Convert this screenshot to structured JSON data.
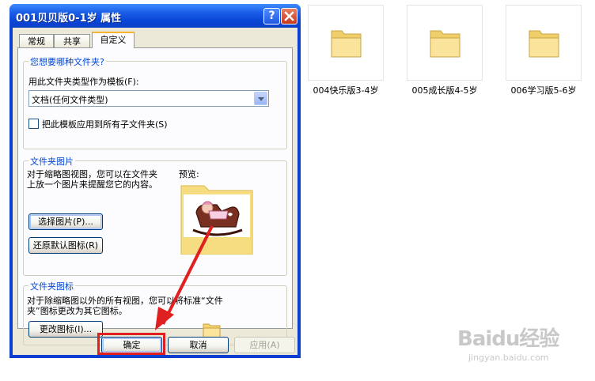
{
  "dialog": {
    "title": "001贝贝版0-1岁 属性",
    "help_btn": "?",
    "close_btn": "✕",
    "tabs": [
      {
        "label": "常规"
      },
      {
        "label": "共享"
      },
      {
        "label": "自定义"
      }
    ],
    "active_tab": "自定义",
    "group_folder_type": {
      "legend": "您想要哪种文件夹?",
      "template_label": "用此文件夹类型作为模板(F):",
      "template_value": "文档(任何文件类型)",
      "apply_checkbox_label": "把此模板应用到所有子文件夹(S)",
      "apply_checked": false
    },
    "group_folder_picture": {
      "legend": "文件夹图片",
      "description_line1": "对于缩略图视图，您可以在文件夹",
      "description_line2": "上放一个图片来提醒您它的内容。",
      "preview_label": "预览:",
      "choose_picture_button": "选择图片(P)...",
      "restore_default_button": "还原默认图标(R)"
    },
    "group_folder_icon": {
      "legend": "文件夹图标",
      "description_line1": "对于除缩略图以外的所有视图，您可以将标准“文件",
      "description_line2": "夹”图标更改为其它图标。",
      "change_icon_button": "更改图标(I)..."
    },
    "footer": {
      "ok_button": "确定",
      "cancel_button": "取消",
      "apply_button": "应用(A)"
    }
  },
  "files": [
    {
      "name": "004快乐版3-4岁",
      "icon": "folder-icon"
    },
    {
      "name": "005成长版4-5岁",
      "icon": "folder-icon"
    },
    {
      "name": "006学习版5-6岁",
      "icon": "folder-icon"
    }
  ],
  "watermark": {
    "main": "Baidu经验",
    "sub": "jingyan.baidu.com"
  },
  "colors": {
    "titlebar": "#0a46d6",
    "legend_text": "#0046d5",
    "highlight": "#e02020",
    "folder_yellow": "#f3d46a"
  }
}
